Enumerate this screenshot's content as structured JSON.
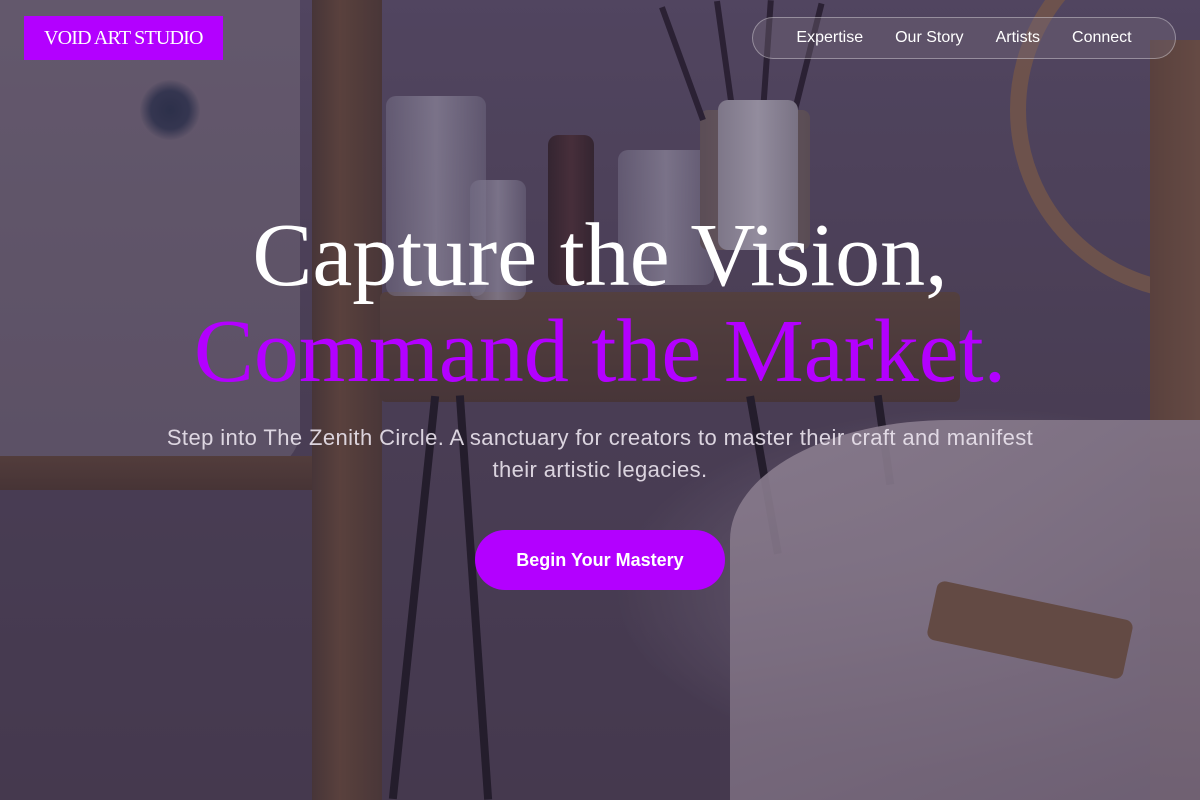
{
  "brand": {
    "logo_text": "VOID ART STUDIO"
  },
  "nav": {
    "items": [
      {
        "label": "Expertise"
      },
      {
        "label": "Our Story"
      },
      {
        "label": "Artists"
      },
      {
        "label": "Connect"
      }
    ]
  },
  "hero": {
    "headline_line1": "Capture the Vision,",
    "headline_line2": "Command the Market.",
    "subtitle": "Step into The Zenith Circle. A sanctuary for creators to master their craft and manifest their artistic legacies.",
    "cta_label": "Begin Your Mastery"
  },
  "colors": {
    "accent": "#b300ff",
    "text_primary": "#ffffff",
    "overlay": "#2d1e3c"
  }
}
